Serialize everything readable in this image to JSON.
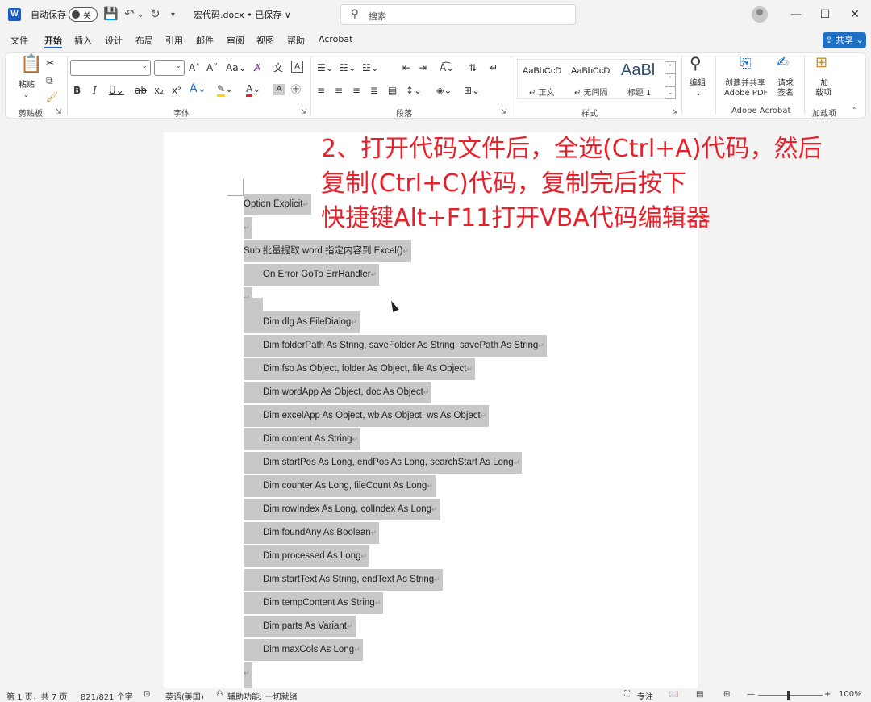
{
  "titlebar": {
    "logo_letter": "W",
    "autosave_label": "自动保存",
    "autosave_state": "关",
    "doc_title": "宏代码.docx • 已保存 ∨",
    "search_placeholder": "搜索"
  },
  "tabs": [
    "文件",
    "开始",
    "插入",
    "设计",
    "布局",
    "引用",
    "邮件",
    "审阅",
    "视图",
    "帮助",
    "Acrobat"
  ],
  "active_tab": "开始",
  "share_label": "共享",
  "ribbon": {
    "clipboard": {
      "paste_label": "粘贴",
      "group_label": "剪贴板"
    },
    "font": {
      "group_label": "字体",
      "font_name": "",
      "font_size": ""
    },
    "paragraph": {
      "group_label": "段落"
    },
    "styles": {
      "group_label": "样式",
      "items": [
        {
          "sample": "AaBbCcD",
          "name": "↵ 正文"
        },
        {
          "sample": "AaBbCcD",
          "name": "↵ 无间隔"
        },
        {
          "sample": "AaBl",
          "name": "标题 1"
        }
      ]
    },
    "editing": {
      "label": "编辑"
    },
    "acrobat": {
      "create_label_1": "创建并共享",
      "create_label_2": "Adobe PDF",
      "sign_label_1": "请求",
      "sign_label_2": "签名",
      "group_label": "Adobe Acrobat"
    },
    "addins": {
      "label_1": "加",
      "label_2": "载项",
      "group_label": "加载项"
    }
  },
  "annotation": {
    "lines": [
      "2、打开代码文件后，全选(Ctrl+A)代码，然后",
      "复制(Ctrl+C)代码，复制完后按下",
      "快捷键Alt+F11打开VBA代码编辑器"
    ],
    "color": "#e8202a"
  },
  "document": {
    "lines": [
      "Option Explicit",
      "",
      "Sub  批量提取 word 指定内容到 Excel()",
      "On Error GoTo ErrHandler",
      "",
      "",
      "Dim dlg As FileDialog",
      "Dim folderPath As String, saveFolder As String, savePath As String",
      "Dim fso As Object, folder As Object, file As Object",
      "Dim wordApp As Object, doc As Object",
      "Dim excelApp As Object, wb As Object, ws As Object",
      "Dim content As String",
      "Dim startPos As Long, endPos As Long, searchStart As Long",
      "Dim counter As Long, fileCount As Long",
      "Dim rowIndex As Long, colIndex As Long",
      "Dim foundAny As Boolean",
      "Dim processed As Long",
      "Dim startText As String, endText As String",
      "Dim tempContent As String",
      "Dim parts As Variant",
      "Dim maxCols As Long",
      ""
    ]
  },
  "statusbar": {
    "page": "第 1 页，共 7 页",
    "words": "821/821 个字",
    "language": "英语(美国)",
    "accessibility": "辅助功能: 一切就绪",
    "focus": "专注",
    "zoom": "100%"
  }
}
